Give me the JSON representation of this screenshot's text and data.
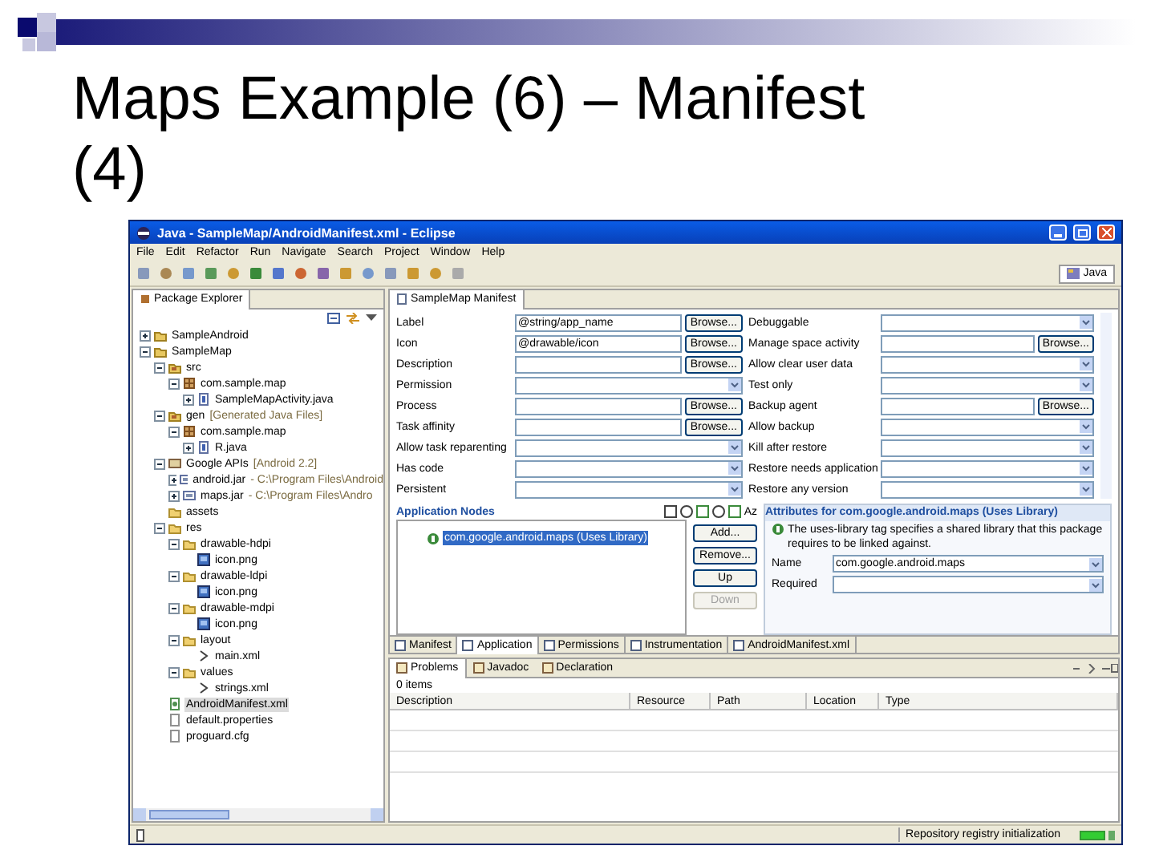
{
  "slide": {
    "title": "Maps Example (6) – Manifest (4)"
  },
  "window": {
    "title": "Java - SampleMap/AndroidManifest.xml - Eclipse",
    "menu": [
      "File",
      "Edit",
      "Refactor",
      "Run",
      "Navigate",
      "Search",
      "Project",
      "Window",
      "Help"
    ],
    "perspective": "Java"
  },
  "package_explorer": {
    "title": "Package Explorer",
    "tree": [
      {
        "label": "SampleAndroid",
        "kind": "project",
        "expanded": false,
        "selected": false
      },
      {
        "label": "SampleMap",
        "kind": "project",
        "expanded": true,
        "selected": false,
        "children": [
          {
            "label": "src",
            "kind": "srcfolder",
            "expanded": true,
            "selected": false,
            "children": [
              {
                "label": "com.sample.map",
                "kind": "package",
                "expanded": true,
                "selected": false,
                "children": [
                  {
                    "label": "SampleMapActivity.java",
                    "kind": "java",
                    "expanded": false,
                    "selected": false
                  }
                ]
              }
            ]
          },
          {
            "label": "gen",
            "decoration": "[Generated Java Files]",
            "kind": "srcfolder",
            "expanded": true,
            "selected": false,
            "children": [
              {
                "label": "com.sample.map",
                "kind": "package",
                "expanded": true,
                "selected": false,
                "children": [
                  {
                    "label": "R.java",
                    "kind": "java",
                    "expanded": false,
                    "selected": false
                  }
                ]
              }
            ]
          },
          {
            "label": "Google APIs",
            "decoration": "[Android 2.2]",
            "kind": "library",
            "expanded": true,
            "selected": false,
            "children": [
              {
                "label": "android.jar",
                "decoration": "- C:\\Program Files\\Android",
                "kind": "jar",
                "expanded": false,
                "selected": false
              },
              {
                "label": "maps.jar",
                "decoration": "- C:\\Program Files\\Andro",
                "kind": "jar",
                "expanded": false,
                "selected": false
              }
            ]
          },
          {
            "label": "assets",
            "kind": "folder",
            "selected": false
          },
          {
            "label": "res",
            "kind": "folder",
            "expanded": true,
            "selected": false,
            "children": [
              {
                "label": "drawable-hdpi",
                "kind": "folder",
                "expanded": true,
                "selected": false,
                "children": [
                  {
                    "label": "icon.png",
                    "kind": "image",
                    "selected": false
                  }
                ]
              },
              {
                "label": "drawable-ldpi",
                "kind": "folder",
                "expanded": true,
                "selected": false,
                "children": [
                  {
                    "label": "icon.png",
                    "kind": "image",
                    "selected": false
                  }
                ]
              },
              {
                "label": "drawable-mdpi",
                "kind": "folder",
                "expanded": true,
                "selected": false,
                "children": [
                  {
                    "label": "icon.png",
                    "kind": "image",
                    "selected": false
                  }
                ]
              },
              {
                "label": "layout",
                "kind": "folder",
                "expanded": true,
                "selected": false,
                "children": [
                  {
                    "label": "main.xml",
                    "kind": "xml",
                    "selected": false
                  }
                ]
              },
              {
                "label": "values",
                "kind": "folder",
                "expanded": true,
                "selected": false,
                "children": [
                  {
                    "label": "strings.xml",
                    "kind": "xml",
                    "selected": false
                  }
                ]
              }
            ]
          },
          {
            "label": "AndroidManifest.xml",
            "kind": "manifest",
            "selected": true
          },
          {
            "label": "default.properties",
            "kind": "text",
            "selected": false
          },
          {
            "label": "proguard.cfg",
            "kind": "text",
            "selected": false
          }
        ]
      }
    ]
  },
  "editor": {
    "tab": "SampleMap Manifest",
    "fields_left": [
      {
        "label": "Label",
        "kind": "browse",
        "value": "@string/app_name",
        "button": "Browse..."
      },
      {
        "label": "Icon",
        "kind": "browse",
        "value": "@drawable/icon",
        "button": "Browse..."
      },
      {
        "label": "Description",
        "kind": "browse",
        "button": "Browse..."
      },
      {
        "label": "Permission",
        "kind": "combo"
      },
      {
        "label": "Process",
        "kind": "browse",
        "button": "Browse..."
      },
      {
        "label": "Task affinity",
        "kind": "browse",
        "button": "Browse..."
      },
      {
        "label": "Allow task reparenting",
        "kind": "combo"
      },
      {
        "label": "Has code",
        "kind": "combo"
      },
      {
        "label": "Persistent",
        "kind": "combo"
      }
    ],
    "fields_right": [
      {
        "label": "Debuggable",
        "kind": "combo"
      },
      {
        "label": "Manage space activity",
        "kind": "browse",
        "button": "Browse..."
      },
      {
        "label": "Allow clear user data",
        "kind": "combo"
      },
      {
        "label": "Test only",
        "kind": "combo"
      },
      {
        "label": "Backup agent",
        "kind": "browse",
        "button": "Browse..."
      },
      {
        "label": "Allow backup",
        "kind": "combo"
      },
      {
        "label": "Kill after restore",
        "kind": "combo"
      },
      {
        "label": "Restore needs application",
        "kind": "combo"
      },
      {
        "label": "Restore any version",
        "kind": "combo"
      }
    ],
    "nodes": {
      "title": "Application Nodes",
      "sort_label": "Az",
      "items": [
        {
          "label": "com.google.android.maps (Uses Library)",
          "selected": true
        }
      ],
      "buttons": [
        {
          "label": "Add...",
          "disabled": false
        },
        {
          "label": "Remove...",
          "disabled": false
        },
        {
          "label": "Up",
          "disabled": false
        },
        {
          "label": "Down",
          "disabled": true
        }
      ]
    },
    "attributes": {
      "title": "Attributes for com.google.android.maps (Uses Library)",
      "description": "The uses-library tag specifies a shared library that this package requires to be linked against.",
      "fields": [
        {
          "label": "Name",
          "value": "com.google.android.maps"
        },
        {
          "label": "Required"
        }
      ]
    },
    "tabs": [
      {
        "label": "Manifest",
        "selected": false
      },
      {
        "label": "Application",
        "selected": true
      },
      {
        "label": "Permissions",
        "selected": false
      },
      {
        "label": "Instrumentation",
        "selected": false
      },
      {
        "label": "AndroidManifest.xml",
        "selected": false
      }
    ]
  },
  "problems": {
    "tabs": [
      {
        "label": "Problems",
        "selected": true
      },
      {
        "label": "Javadoc",
        "selected": false
      },
      {
        "label": "Declaration",
        "selected": false
      }
    ],
    "summary": "0 items",
    "columns": [
      "Description",
      "Resource",
      "Path",
      "Location",
      "Type"
    ]
  },
  "status_bar": {
    "message": "Repository registry initialization"
  }
}
